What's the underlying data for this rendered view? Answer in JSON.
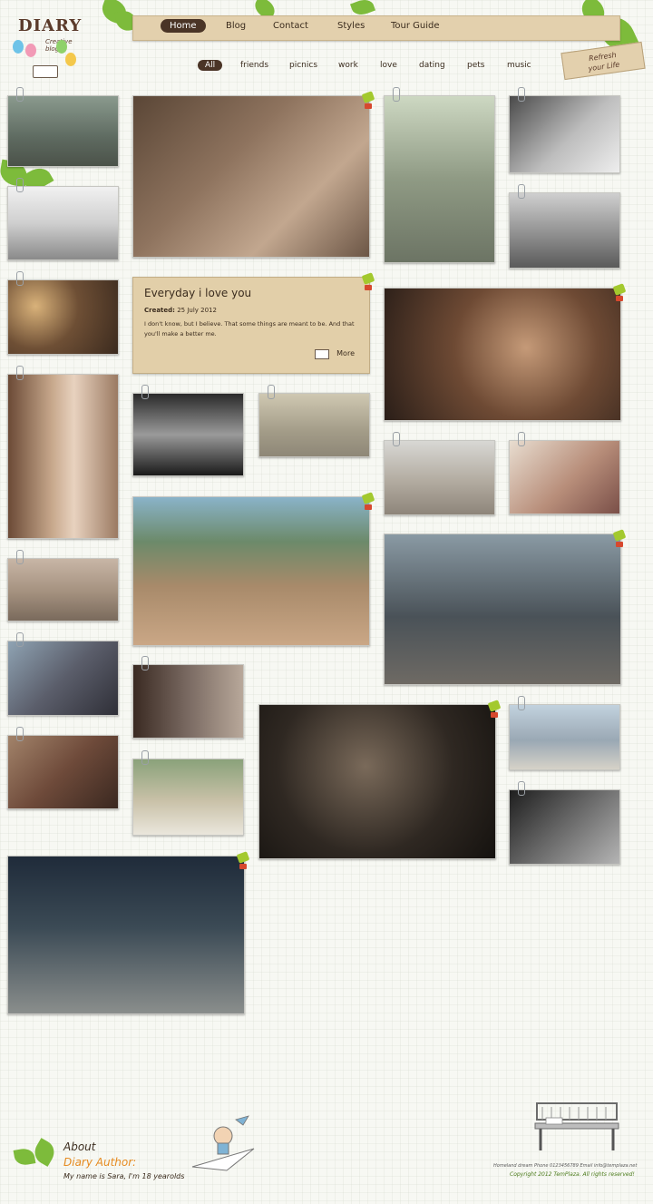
{
  "logo": {
    "word": "DIARY",
    "tagline": "Creative blog"
  },
  "nav": {
    "items": [
      "Home",
      "Blog",
      "Contact",
      "Styles",
      "Tour Guide"
    ],
    "active": "Home"
  },
  "filters": {
    "items": [
      "All",
      "friends",
      "picnics",
      "work",
      "love",
      "dating",
      "pets",
      "music"
    ],
    "active": "All"
  },
  "tag": {
    "line1": "Refresh",
    "line2": "your Life"
  },
  "post": {
    "title": "Everyday i love you",
    "created_label": "Created:",
    "created_date": "25 July 2012",
    "body": "I don't know, but I believe. That some things are meant to be. And that you'll make a better me.",
    "more_label": "More"
  },
  "footer": {
    "about": "About",
    "author": "Diary Author:",
    "myname": "My name is Sara, I'm 18 yearolds",
    "contact_line": "Homeland dream Phone 0123456789 Email info@templaza.net",
    "copyright": "Copyright 2012 TemPlaza. All rights reserved!"
  },
  "colors": {
    "nav_bg": "#e3d0ad",
    "nav_active": "#4a3426",
    "leaf_green": "#7dbb3b",
    "author_orange": "#e68a1f",
    "copyright_green": "#4b7b1b"
  }
}
